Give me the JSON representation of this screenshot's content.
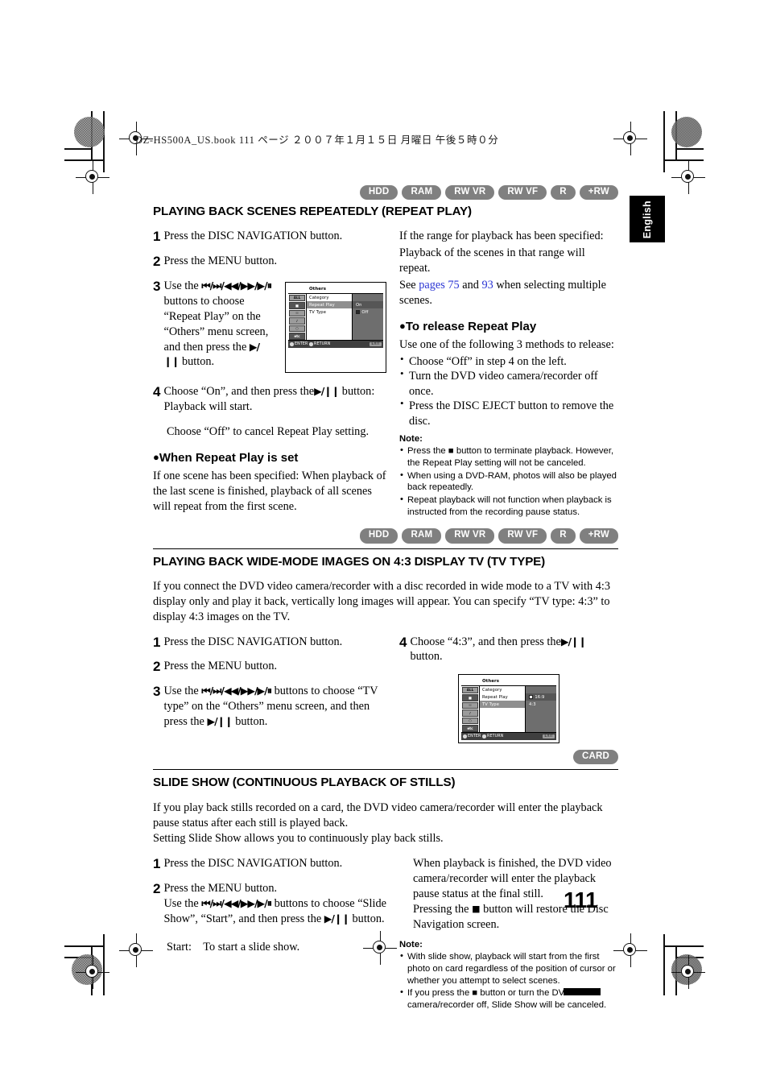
{
  "header": {
    "file_line": "DZ-HS500A_US.book   111 ページ   ２００７年１月１５日   月曜日   午後５時０分"
  },
  "side_tab": {
    "label": "English"
  },
  "page_number": "111",
  "sections": [
    {
      "id": "repeat-play",
      "badges": [
        "HDD",
        "RAM",
        "RW VR",
        "RW VF",
        "R",
        "+RW"
      ],
      "title": "PLAYING BACK SCENES REPEATEDLY (REPEAT PLAY)",
      "left": {
        "step1_num": "1",
        "step1_text": "Press the DISC NAVIGATION button.",
        "step2_num": "2",
        "step2_text": "Press the MENU button.",
        "step3_num": "3",
        "step3_a": "Use the",
        "step3_glyphs": "⏮/⏭/◀◀/▶▶/▶/⏸",
        "step3_b": "buttons to choose “Repeat Play” on the “Others” menu screen, and then press the",
        "step3_c": "button.",
        "step4_num": "4",
        "step4_a": "Choose “On”, and then press the",
        "step4_b": "button: Playback will start.",
        "step4_note": "Choose “Off” to cancel Repeat Play setting.",
        "sub_head": "When Repeat Play is set",
        "sub_body": "If one scene has been specified: When playback of the last scene is finished, playback of all scenes will repeat from the first scene."
      },
      "right": {
        "intro_line1": "If the range for playback has been specified:",
        "intro_line2": "Playback of the scenes in that range will repeat.",
        "see_prefix": "See",
        "see_link1": "pages 75",
        "see_mid": "and",
        "see_link2": "93",
        "see_suffix": "when selecting multiple scenes.",
        "sub_head": "To release Repeat Play",
        "sub_intro": "Use one of the following 3 methods to release:",
        "methods": [
          "Choose “Off” in step 4 on the left.",
          "Turn the DVD video camera/recorder off once.",
          "Press the DISC EJECT button to remove the disc."
        ],
        "note_label": "Note:",
        "notes": [
          "Press the ■ button to terminate playback. However, the Repeat Play setting will not be canceled.",
          "When using a DVD-RAM, photos will also be played back repeatedly.",
          "Repeat playback will not function when playback is instructed from the recording pause status."
        ]
      },
      "menu": {
        "title": "Others",
        "items": [
          "Category",
          "Repeat Play",
          "TV Type"
        ],
        "selected_item": "Repeat Play",
        "values": [
          "On",
          "Off"
        ],
        "selected_value": "Off",
        "rail": [
          "ALL",
          "■",
          "☉",
          "♪",
          "○",
          "etc"
        ],
        "footer_enter": "ENTER",
        "footer_return": "RETURN",
        "footer_exit": "EXIT"
      }
    },
    {
      "id": "tv-type",
      "badges": [
        "HDD",
        "RAM",
        "RW VR",
        "RW VF",
        "R",
        "+RW"
      ],
      "title": "PLAYING BACK WIDE-MODE IMAGES ON 4:3 DISPLAY TV (TV TYPE)",
      "intro": "If you connect the DVD video camera/recorder with a disc recorded in wide mode to a TV with 4:3 display only and play it back, vertically long images will appear. You can specify “TV type: 4:3” to display 4:3 images on the TV.",
      "left": {
        "step1_num": "1",
        "step1_text": "Press the DISC NAVIGATION button.",
        "step2_num": "2",
        "step2_text": "Press the MENU button.",
        "step3_num": "3",
        "step3_a": "Use the",
        "step3_glyphs": "⏮/⏭/◀◀/▶▶/▶/⏸",
        "step3_b": "buttons to choose “TV type” on the “Others” menu screen, and then press the",
        "step3_c": "button."
      },
      "right": {
        "step4_num": "4",
        "step4_a": "Choose “4:3”, and then press the",
        "step4_b": "button."
      },
      "menu": {
        "title": "Others",
        "items": [
          "Category",
          "Repeat Play",
          "TV Type"
        ],
        "selected_item": "TV Type",
        "values": [
          "16:9",
          "4:3"
        ],
        "selected_value": "16:9",
        "rail": [
          "ALL",
          "■",
          "☉",
          "♪",
          "○",
          "etc"
        ],
        "footer_enter": "ENTER",
        "footer_return": "RETURN",
        "footer_exit": "EXIT"
      }
    },
    {
      "id": "slide-show",
      "badges": [
        "CARD"
      ],
      "title": "SLIDE SHOW (CONTINUOUS PLAYBACK OF STILLS)",
      "intro_line1": "If you play back stills recorded on a card, the DVD video camera/recorder will enter the playback pause status after each still is played back.",
      "intro_line2": "Setting Slide Show allows you to continuously play back stills.",
      "left": {
        "step1_num": "1",
        "step1_text": "Press the DISC NAVIGATION button.",
        "step2_num": "2",
        "step2_text": "Press the MENU button.",
        "step2_a": "Use the",
        "step2_glyphs": "⏮/⏭/◀◀/▶▶/▶/⏸",
        "step2_b": "buttons to choose “Slide Show”, “Start”, and then press the",
        "step2_c": "button.",
        "start_label": "Start:",
        "start_desc": "To start a slide show."
      },
      "right": {
        "body_line1": "When playback is finished, the DVD video camera/recorder will enter the playback pause status at the final still.",
        "body_line2_a": "Pressing the",
        "body_line2_b": "button will restore the Disc Navigation screen.",
        "note_label": "Note:",
        "notes": [
          "With slide show, playback will start from the first photo on card regardless of the position of cursor or whether you attempt to select scenes.",
          "If you press the ■ button or turn the DVD video camera/recorder off, Slide Show will be canceled."
        ]
      }
    }
  ],
  "colors": {
    "badge_bg": "#808080",
    "link": "#2b35d4",
    "tab_bg": "#000000"
  }
}
